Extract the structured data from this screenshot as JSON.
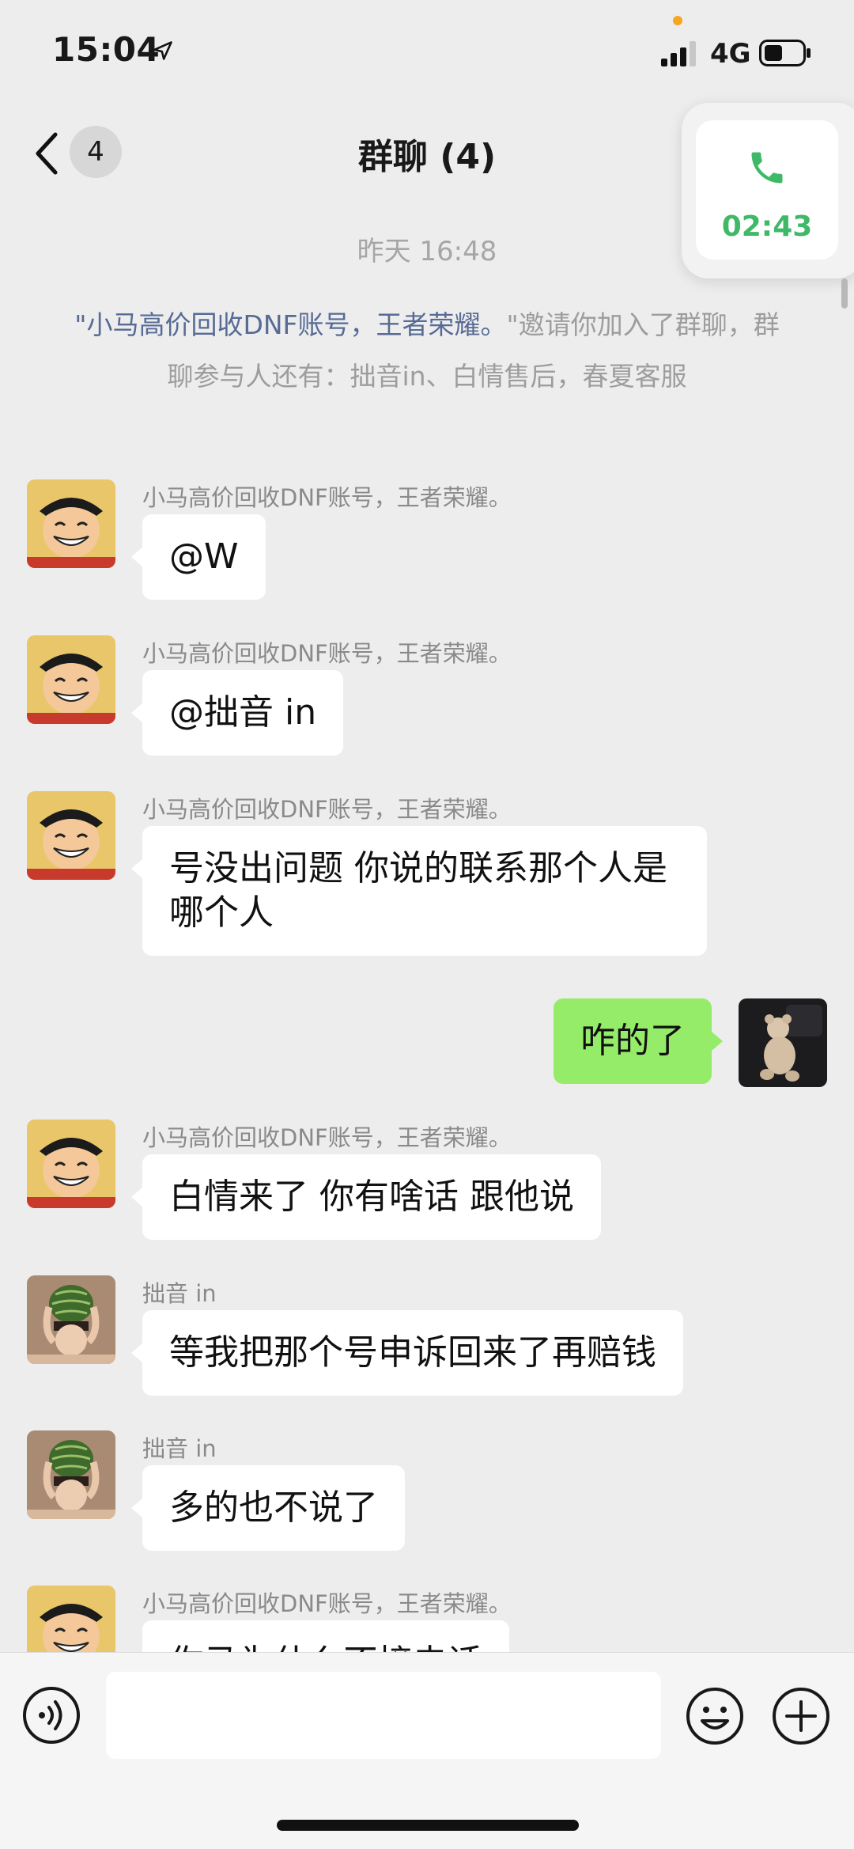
{
  "status_bar": {
    "time": "15:04",
    "network": "4G"
  },
  "nav": {
    "unread_count": "4",
    "title": "群聊 (4)"
  },
  "call": {
    "timer": "02:43"
  },
  "chat": {
    "timestamp": "昨天 16:48",
    "system_notice": {
      "quote_open": "\"",
      "inviter": "小马高价回收DNF账号，王者荣耀。",
      "rest": "\"邀请你加入了群聊，群聊参与人还有：拙音in、白情售后，春夏客服"
    },
    "messages": [
      {
        "sender": "小马高价回收DNF账号，王者荣耀。",
        "text": "@W",
        "direction": "in"
      },
      {
        "sender": "小马高价回收DNF账号，王者荣耀。",
        "text": "@拙音 in",
        "direction": "in"
      },
      {
        "sender": "小马高价回收DNF账号，王者荣耀。",
        "text": "号没出问题 你说的联系那个人是哪个人",
        "direction": "in"
      },
      {
        "sender": "",
        "text": "咋的了",
        "direction": "out"
      },
      {
        "sender": "小马高价回收DNF账号，王者荣耀。",
        "text": "白情来了 你有啥话 跟他说",
        "direction": "in"
      },
      {
        "sender": "拙音 in",
        "text": "等我把那个号申诉回来了再赔钱",
        "direction": "in"
      },
      {
        "sender": "拙音 in",
        "text": "多的也不说了",
        "direction": "in"
      },
      {
        "sender": "小马高价回收DNF账号，王者荣耀。",
        "text": "你马为什么不接电话",
        "direction": "in"
      }
    ]
  },
  "input": {
    "placeholder": ""
  },
  "icons": {
    "back": "chevron-left-icon",
    "phone": "phone-icon",
    "voice": "voice-icon",
    "emoji": "emoji-icon",
    "plus": "plus-icon"
  },
  "colors": {
    "background": "#ededed",
    "bubble_in": "#ffffff",
    "bubble_out": "#95ec69",
    "call_green": "#3fb968",
    "link_blue": "#576b95"
  }
}
